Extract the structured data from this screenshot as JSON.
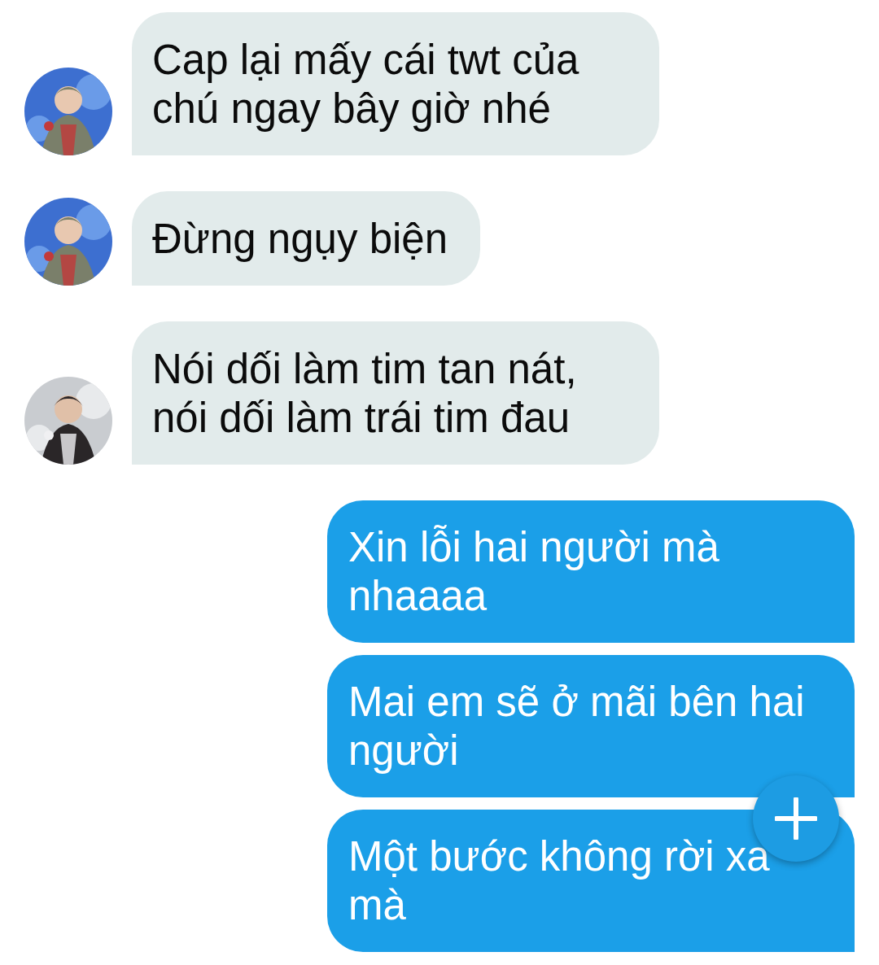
{
  "messages": [
    {
      "kind": "received",
      "text": "Cap lại mấy cái twt của chú ngay bây giờ nhé"
    },
    {
      "kind": "received",
      "text": "Đừng ngụy biện"
    },
    {
      "kind": "received",
      "text": "Nói dối làm tim tan nát, nói dối làm trái tim đau"
    },
    {
      "kind": "sent",
      "text": "Xin lỗi hai người mà nhaaaa"
    },
    {
      "kind": "sent",
      "text": "Mai em sẽ ở mãi bên hai người"
    },
    {
      "kind": "sent",
      "text": "Một bước không rời xa mà"
    }
  ],
  "compose_button": {
    "kind": "add"
  }
}
